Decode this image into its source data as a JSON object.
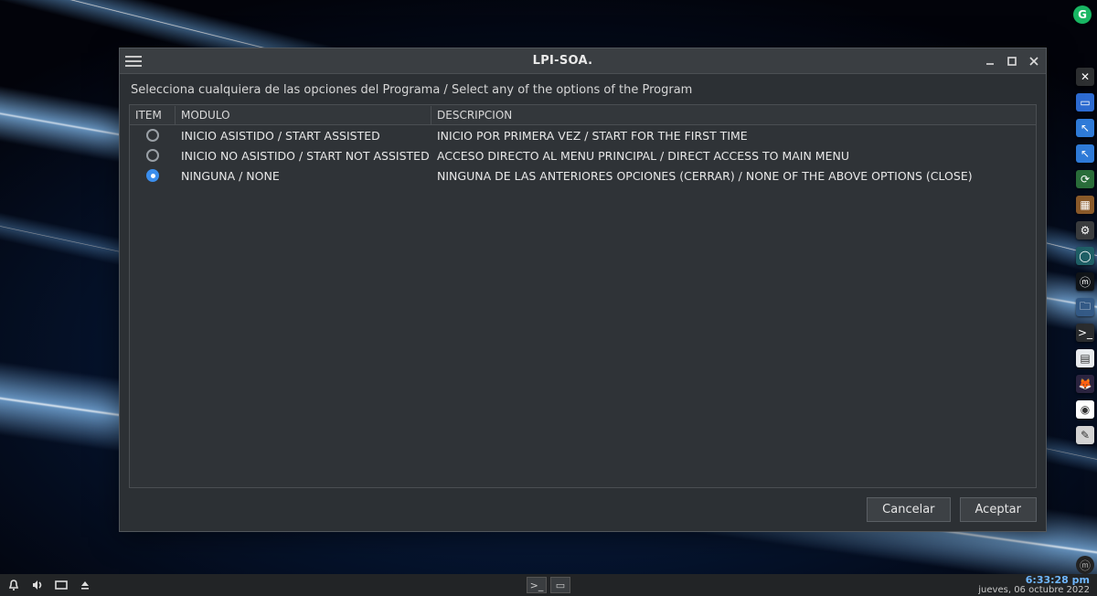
{
  "desktop": {
    "corner_badge_letter": "G"
  },
  "window": {
    "title": "LPI-SOA.",
    "subtitle": "Selecciona cualquiera de las opciones del Programa / Select any of the options of the Program",
    "columns": {
      "item": "ITEM",
      "modulo": "MODULO",
      "descripcion": "DESCRIPCION"
    },
    "rows": [
      {
        "selected": false,
        "modulo": "INICIO ASISTIDO / START ASSISTED",
        "descripcion": "INICIO POR PRIMERA VEZ / START FOR THE FIRST TIME"
      },
      {
        "selected": false,
        "modulo": "INICIO NO ASISTIDO / START NOT ASSISTED",
        "descripcion": "ACCESO DIRECTO AL MENU PRINCIPAL / DIRECT ACCESS TO MAIN MENU"
      },
      {
        "selected": true,
        "modulo": "NINGUNA / NONE",
        "descripcion": "NINGUNA DE LAS ANTERIORES OPCIONES (CERRAR) / NONE OF THE ABOVE OPTIONS (CLOSE)"
      }
    ],
    "buttons": {
      "cancel": "Cancelar",
      "accept": "Aceptar"
    }
  },
  "dock": {
    "items": [
      {
        "name": "close-tray-icon",
        "bg": "#2d2f31",
        "glyph": "✕"
      },
      {
        "name": "display-settings-icon",
        "bg": "#2d6bd1",
        "glyph": "▭"
      },
      {
        "name": "cursor-white-icon",
        "bg": "#2f7bd8",
        "glyph": "↖"
      },
      {
        "name": "cursor-blue-icon",
        "bg": "#2f7bd8",
        "glyph": "↖"
      },
      {
        "name": "refresh-icon",
        "bg": "#2a6d3a",
        "glyph": "⟳"
      },
      {
        "name": "package-icon",
        "bg": "#8a5a2a",
        "glyph": "▦"
      },
      {
        "name": "gear-icon",
        "bg": "#3a3c3e",
        "glyph": "⚙"
      },
      {
        "name": "circle-app-icon",
        "bg": "#1f5f66",
        "glyph": "◯"
      },
      {
        "name": "m-app-icon",
        "bg": "#101418",
        "glyph": "ⓜ"
      },
      {
        "name": "files-icon",
        "bg": "#345a86",
        "glyph": "🗀"
      },
      {
        "name": "terminal-icon",
        "bg": "#2a2c2e",
        "glyph": ">_"
      },
      {
        "name": "document-icon",
        "bg": "#e9ecef",
        "glyph": "▤"
      },
      {
        "name": "firefox-icon",
        "bg": "#2b2440",
        "glyph": "🦊"
      },
      {
        "name": "chrome-icon",
        "bg": "#ffffff",
        "glyph": "◉"
      },
      {
        "name": "tools-icon",
        "bg": "#d4d4d4",
        "glyph": "✎"
      }
    ]
  },
  "taskbar": {
    "time": "6:33:28 pm",
    "date": "jueves, 06 octubre 2022"
  }
}
